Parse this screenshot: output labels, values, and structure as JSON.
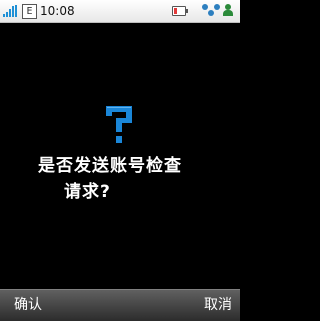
{
  "status_bar": {
    "network_label": "E",
    "time": "10:08",
    "icons": [
      "signal-icon",
      "network-e-icon",
      "battery-icon",
      "bluetooth-icon",
      "profile-icon"
    ],
    "battery_level": 0.25,
    "colors": {
      "signal": "#1e90d6",
      "battery_fill": "#e23a3a",
      "bluetooth": "#2d7fbf",
      "profile": "#2b8a3a"
    }
  },
  "dialog": {
    "icon": "question-mark-icon",
    "icon_color": "#1a86d8",
    "message_line1": "是否发送账号检查",
    "message_line2": "请求?"
  },
  "softkeys": {
    "left_label": "确认",
    "right_label": "取消"
  }
}
